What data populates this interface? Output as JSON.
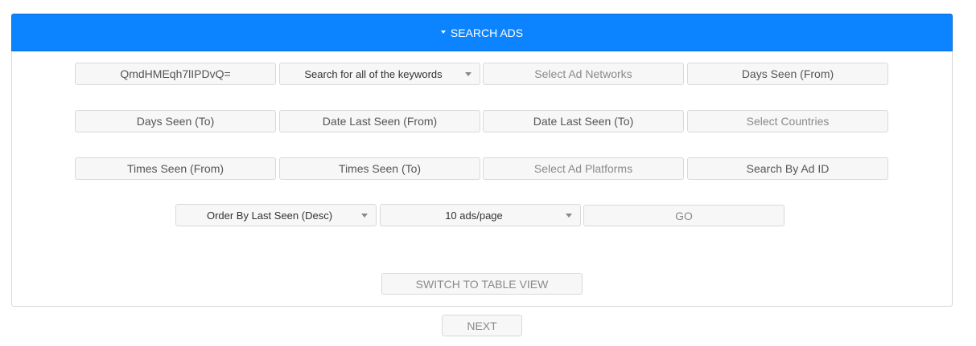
{
  "header": {
    "title": "SEARCH ADS",
    "icon": "caret-down-icon"
  },
  "row1": {
    "keyword_value": "QmdHMEqh7lIPDvQ=",
    "match_mode": "Search for all of the keywords",
    "ad_networks_placeholder": "Select Ad Networks",
    "days_seen_from_placeholder": "Days Seen (From)"
  },
  "row2": {
    "days_seen_to_placeholder": "Days Seen (To)",
    "date_last_seen_from_placeholder": "Date Last Seen (From)",
    "date_last_seen_to_placeholder": "Date Last Seen (To)",
    "countries_placeholder": "Select Countries"
  },
  "row3": {
    "times_seen_from_placeholder": "Times Seen (From)",
    "times_seen_to_placeholder": "Times Seen (To)",
    "ad_platforms_placeholder": "Select Ad Platforms",
    "ad_id_placeholder": "Search By Ad ID"
  },
  "row4": {
    "order_by": "Order By Last Seen (Desc)",
    "per_page": "10 ads/page",
    "go_label": "GO"
  },
  "switch_view_label": "SWITCH TO TABLE VIEW",
  "next_label": "NEXT"
}
